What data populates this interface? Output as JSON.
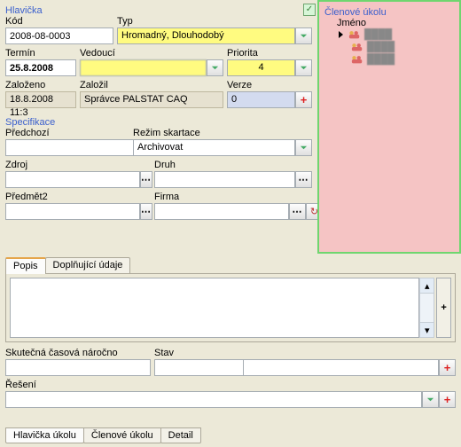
{
  "hlavicka": {
    "title": "Hlavička",
    "kod_label": "Kód",
    "kod_value": "2008-08-0003",
    "typ_label": "Typ",
    "typ_value": "Hromadný, Dlouhodobý",
    "termin_label": "Termín",
    "termin_value": "25.8.2008",
    "vedouci_label": "Vedoucí",
    "vedouci_value": "",
    "priorita_label": "Priorita",
    "priorita_value": "4",
    "zalozeno_label": "Založeno",
    "zalozeno_value": "18.8.2008 11:3",
    "zalozil_label": "Založil",
    "zalozil_value": "Správce PALSTAT CAQ",
    "verze_label": "Verze",
    "verze_value": "0"
  },
  "specifikace": {
    "title": "Specifikace",
    "predchozi_label": "Předchozí",
    "rezim_label": "Režim skartace",
    "rezim_value": "Archivovat",
    "zdroj_label": "Zdroj",
    "druh_label": "Druh",
    "predmet2_label": "Předmět2",
    "firma_label": "Firma"
  },
  "tabs": {
    "popis": "Popis",
    "doplnujici": "Doplňující údaje"
  },
  "dolni": {
    "skutecna_label": "Skutečná  časová náročno",
    "stav_label": "Stav",
    "reseni_label": "Řešení"
  },
  "clenove": {
    "title": "Členové úkolu",
    "jmeno": "Jméno",
    "items": [
      "████",
      "████",
      "████"
    ]
  },
  "bottom_tabs": {
    "hlavicka": "Hlavička úkolu",
    "clenove": "Členové úkolu",
    "detail": "Detail"
  }
}
